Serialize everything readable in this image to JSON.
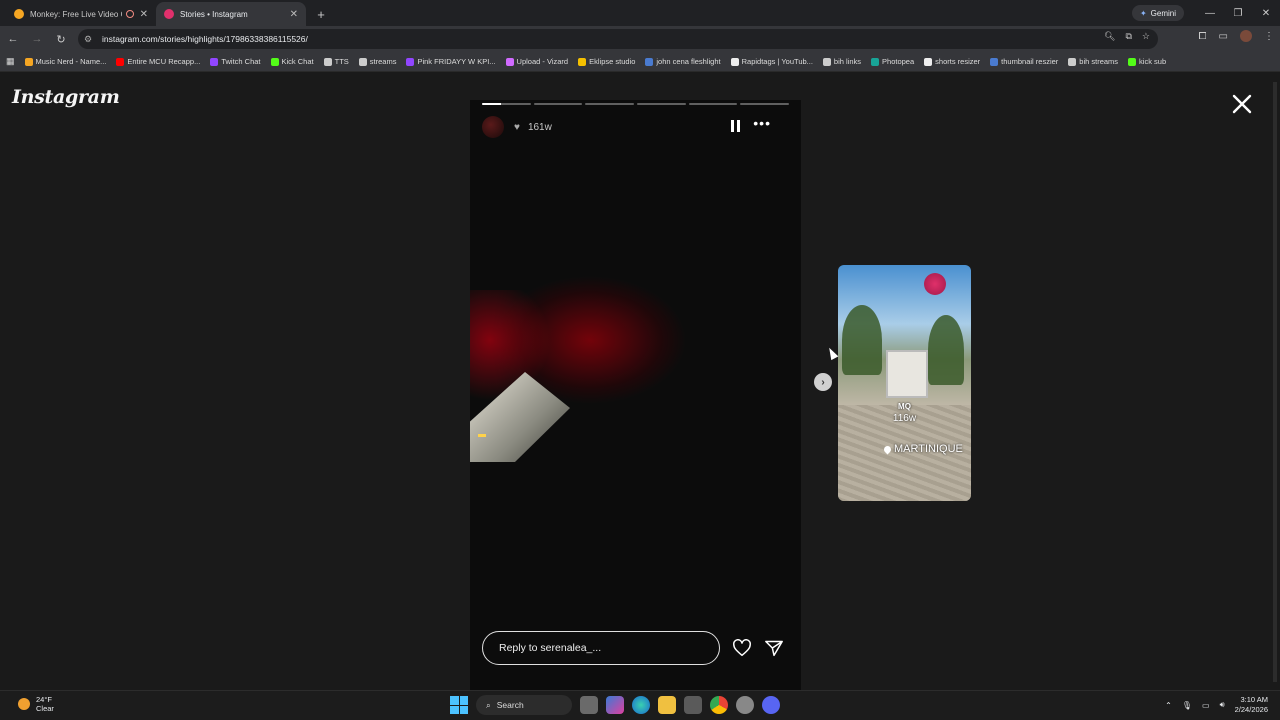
{
  "browser": {
    "tabs": [
      {
        "title": "Monkey: Free Live Video Ch",
        "active": false,
        "fav_color": "#f5a623"
      },
      {
        "title": "Stories • Instagram",
        "active": true,
        "fav_color": "#e1306c"
      }
    ],
    "gemini_label": "Gemini",
    "url": "instagram.com/stories/highlights/17986338386115526/",
    "bookmarks": [
      {
        "label": "Music Nerd - Name...",
        "color": "#f5a623"
      },
      {
        "label": "Entire MCU Recapp...",
        "color": "#ff0000"
      },
      {
        "label": "Twitch Chat",
        "color": "#9146ff"
      },
      {
        "label": "Kick Chat",
        "color": "#53fc18"
      },
      {
        "label": "TTS",
        "color": "#cccccc"
      },
      {
        "label": "streams",
        "color": "#cccccc"
      },
      {
        "label": "Pink FRIDAYY W KPI...",
        "color": "#9146ff"
      },
      {
        "label": "Upload - Vizard",
        "color": "#d06aff"
      },
      {
        "label": "Eklipse studio",
        "color": "#f5c000"
      },
      {
        "label": "john cena fleshlight",
        "color": "#4a7bd0"
      },
      {
        "label": "Rapidtags | YouTub...",
        "color": "#eeeeee"
      },
      {
        "label": "bih links",
        "color": "#cccccc"
      },
      {
        "label": "Photopea",
        "color": "#18a497"
      },
      {
        "label": "shorts resizer",
        "color": "#eeeeee"
      },
      {
        "label": "thumbnail reszier",
        "color": "#4a7bd0"
      },
      {
        "label": "bih streams",
        "color": "#cccccc"
      },
      {
        "label": "kick sub",
        "color": "#53fc18"
      }
    ]
  },
  "instagram": {
    "logo": "Instagram",
    "story": {
      "segments": 6,
      "progress": [
        0.4,
        0,
        0,
        0,
        0,
        0
      ],
      "time_ago": "161w",
      "reply_placeholder": "Reply to serenalea_..."
    },
    "next_highlight": {
      "code": "MQ",
      "time_ago": "116w",
      "location": "MARTINIQUE"
    }
  },
  "taskbar": {
    "temperature": "24°F",
    "condition": "Clear",
    "search_label": "Search",
    "time": "3:10 AM",
    "date": "2/24/2026"
  }
}
